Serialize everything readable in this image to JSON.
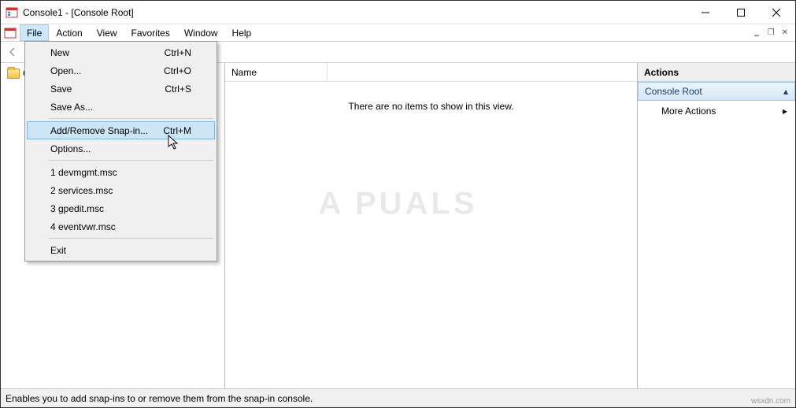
{
  "window": {
    "title": "Console1 - [Console Root]"
  },
  "menubar": {
    "items": [
      "File",
      "Action",
      "View",
      "Favorites",
      "Window",
      "Help"
    ],
    "active_index": 0
  },
  "dropdown": {
    "groups": [
      [
        {
          "label": "New",
          "shortcut": "Ctrl+N"
        },
        {
          "label": "Open...",
          "shortcut": "Ctrl+O"
        },
        {
          "label": "Save",
          "shortcut": "Ctrl+S"
        },
        {
          "label": "Save As...",
          "shortcut": ""
        }
      ],
      [
        {
          "label": "Add/Remove Snap-in...",
          "shortcut": "Ctrl+M",
          "highlighted": true
        },
        {
          "label": "Options...",
          "shortcut": ""
        }
      ],
      [
        {
          "label": "1 devmgmt.msc",
          "shortcut": ""
        },
        {
          "label": "2 services.msc",
          "shortcut": ""
        },
        {
          "label": "3 gpedit.msc",
          "shortcut": ""
        },
        {
          "label": "4 eventvwr.msc",
          "shortcut": ""
        }
      ],
      [
        {
          "label": "Exit",
          "shortcut": ""
        }
      ]
    ]
  },
  "tree": {
    "root_label": "Console Root"
  },
  "content": {
    "empty_text": "There are no items to show in this view.",
    "column_name": "Name"
  },
  "actions": {
    "header": "Actions",
    "root_label": "Console Root",
    "more_actions": "More Actions"
  },
  "statusbar": {
    "text": "Enables you to add snap-ins to or remove them from the snap-in console.",
    "url": "wsxdn.com"
  },
  "watermark": "A   PUALS"
}
